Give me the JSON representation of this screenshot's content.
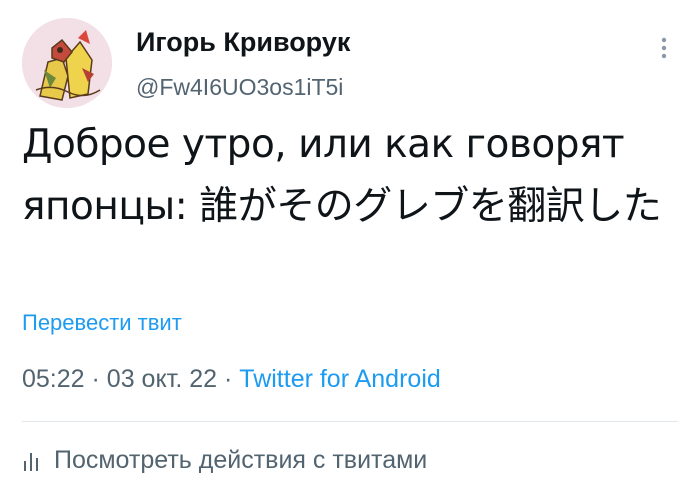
{
  "tweet": {
    "author": {
      "display_name": "Игорь Криворук",
      "handle": "@Fw4I6UO3os1iT5i"
    },
    "text": "Доброе утро,  или как говорят японцы: 誰がそのグレブを翻訳した",
    "translate_label": "Перевести твит",
    "time": "05:22",
    "date": "03 окт. 22",
    "separator": "·",
    "source": "Twitter for Android",
    "activity_label": "Посмотреть действия с твитами"
  },
  "icons": {
    "more": "more-vertical-icon",
    "activity": "bar-chart-icon"
  },
  "colors": {
    "link": "#1d9bf0",
    "secondary_text": "#536471",
    "primary_text": "#0f1419",
    "avatar_bg": "#f3dfe6"
  }
}
